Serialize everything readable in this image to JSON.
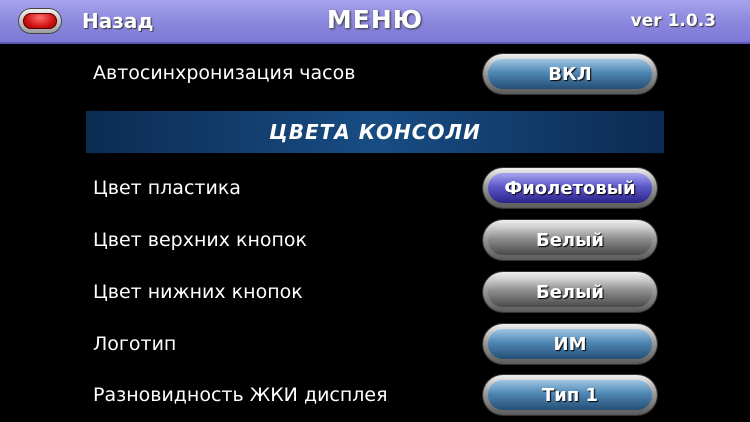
{
  "header": {
    "back_label": "Назад",
    "title": "МЕНЮ",
    "version": "ver 1.0.3"
  },
  "settings": {
    "clock_sync": {
      "label": "Автосинхронизация часов",
      "value": "ВКЛ"
    },
    "section_title": "ЦВЕТА КОНСОЛИ",
    "plastic_color": {
      "label": "Цвет пластика",
      "value": "Фиолетовый"
    },
    "top_buttons_color": {
      "label": "Цвет верхних кнопок",
      "value": "Белый"
    },
    "bottom_buttons_color": {
      "label": "Цвет нижних кнопок",
      "value": "Белый"
    },
    "logo": {
      "label": "Логотип",
      "value": "ИМ"
    },
    "lcd_type": {
      "label": "Разновидность ЖКИ дисплея",
      "value": "Тип 1"
    }
  },
  "colors": {
    "header": "#8f8be0",
    "banner": "#184d84",
    "button_blue": "#4f87b4",
    "button_purple": "#5d58c8",
    "button_gray": "#8e8e8e",
    "back_red": "#d11414"
  }
}
